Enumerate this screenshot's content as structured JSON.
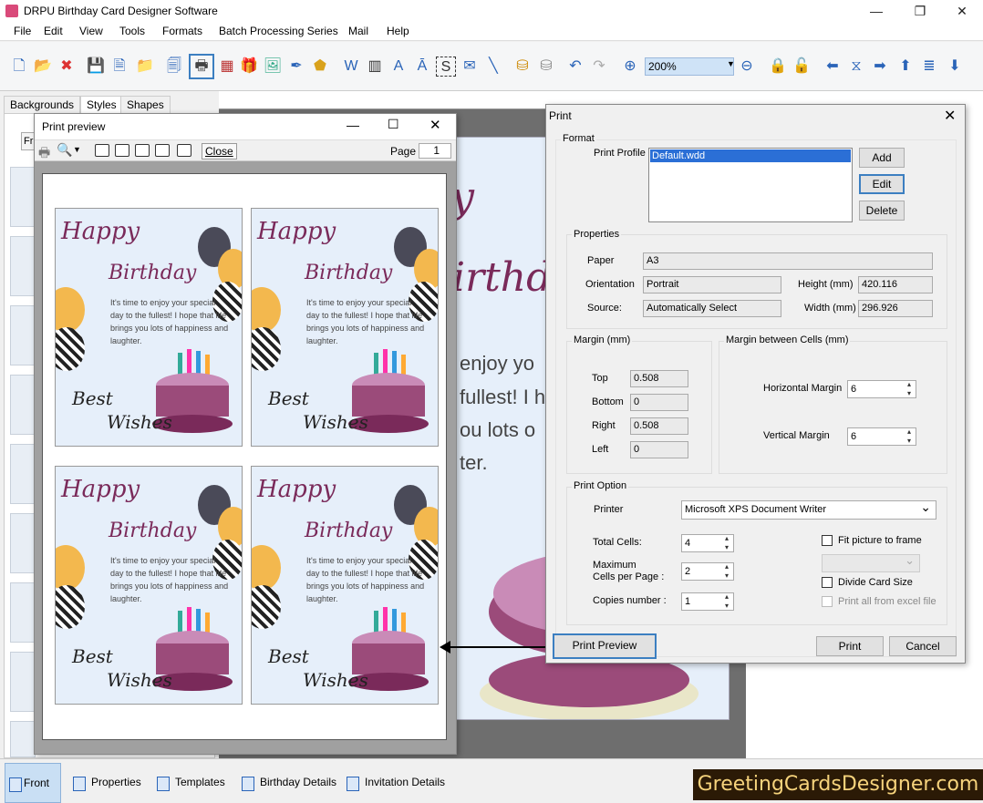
{
  "app": {
    "title": "DRPU Birthday Card Designer Software",
    "menu": [
      "File",
      "Edit",
      "View",
      "Tools",
      "Formats",
      "Batch Processing Series",
      "Mail",
      "Help"
    ],
    "zoom": "200%",
    "left_tabs": [
      "Backgrounds",
      "Styles",
      "Shapes"
    ],
    "left_partial_label": "Fr",
    "bottom_tabs": [
      "Front",
      "Properties",
      "Templates",
      "Birthday Details",
      "Invitation Details"
    ],
    "brand": "GreetingCardsDesigner.com"
  },
  "canvas_card": {
    "heading_partial": "y",
    "heading2_partial": "irthd",
    "lines": [
      "enjoy yo",
      "fullest! I h",
      "ou lots o",
      "ter."
    ]
  },
  "print_preview": {
    "title": "Print preview",
    "close_label": "Close",
    "page_label": "Page",
    "page_value": "1",
    "card": {
      "heading1": "Happy",
      "heading2": "Birthday",
      "body": "It's time to enjoy your special day to the fullest! I hope that life brings you lots of happiness and laughter.",
      "closing1": "Best",
      "closing2": "Wishes"
    }
  },
  "print_dialog": {
    "title": "Print",
    "format_group": "Format",
    "print_profile_label": "Print Profile",
    "profile_selected": "Default.wdd",
    "add_label": "Add",
    "edit_label": "Edit",
    "delete_label": "Delete",
    "properties_group": "Properties",
    "paper_label": "Paper",
    "paper_value": "A3",
    "orientation_label": "Orientation",
    "orientation_value": "Portrait",
    "height_label": "Height (mm)",
    "height_value": "420.116",
    "source_label": "Source:",
    "source_value": "Automatically Select",
    "width_label": "Width (mm)",
    "width_value": "296.926",
    "margin_group": "Margin (mm)",
    "top_label": "Top",
    "top_value": "0.508",
    "bottom_label": "Bottom",
    "bottom_value": "0",
    "right_label": "Right",
    "right_value": "0.508",
    "left_label": "Left",
    "left_value": "0",
    "cell_margin_group": "Margin between Cells (mm)",
    "hmargin_label": "Horizontal Margin",
    "hmargin_value": "6",
    "vmargin_label": "Vertical Margin",
    "vmargin_value": "6",
    "print_option_group": "Print Option",
    "printer_label": "Printer",
    "printer_value": "Microsoft XPS Document Writer",
    "total_cells_label": "Total Cells:",
    "total_cells_value": "4",
    "max_cells_label": "Maximum\nCells per Page :",
    "max_cells_value": "2",
    "copies_label": "Copies number :",
    "copies_value": "1",
    "fit_picture_label": "Fit picture to frame",
    "divide_card_label": "Divide Card Size",
    "print_excel_label": "Print all from excel file",
    "print_preview_label": "Print Preview",
    "print_label": "Print",
    "cancel_label": "Cancel"
  },
  "colors": {
    "accent": "#2a64b8",
    "card_bg": "#e6effa",
    "heading": "#7a2a5a",
    "brand_bg": "#2b1a06",
    "brand_fg": "#f6d37c"
  }
}
